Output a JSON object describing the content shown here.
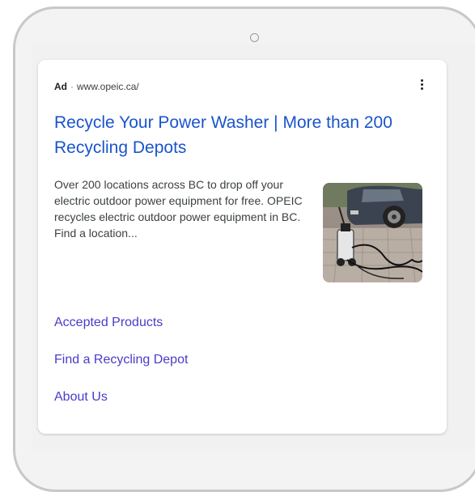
{
  "ad": {
    "label": "Ad",
    "separator": "·",
    "url": "www.opeic.ca/",
    "menu_icon": "more-vert-icon",
    "headline": "Recycle Your Power Washer | More than 200 Recycling Depots",
    "description": "Over 200 locations across BC to drop off your electric outdoor power equipment for free. OPEIC recycles electric outdoor power equipment in BC. Find a location...",
    "thumbnail_icon": "power-washer-photo",
    "sitelinks": [
      {
        "label": "Accepted Products"
      },
      {
        "label": "Find a Recycling Depot"
      },
      {
        "label": "About Us"
      }
    ]
  },
  "colors": {
    "headline": "#1a54cc",
    "sitelink": "#4a3cc8",
    "body_text": "#3c4043"
  }
}
